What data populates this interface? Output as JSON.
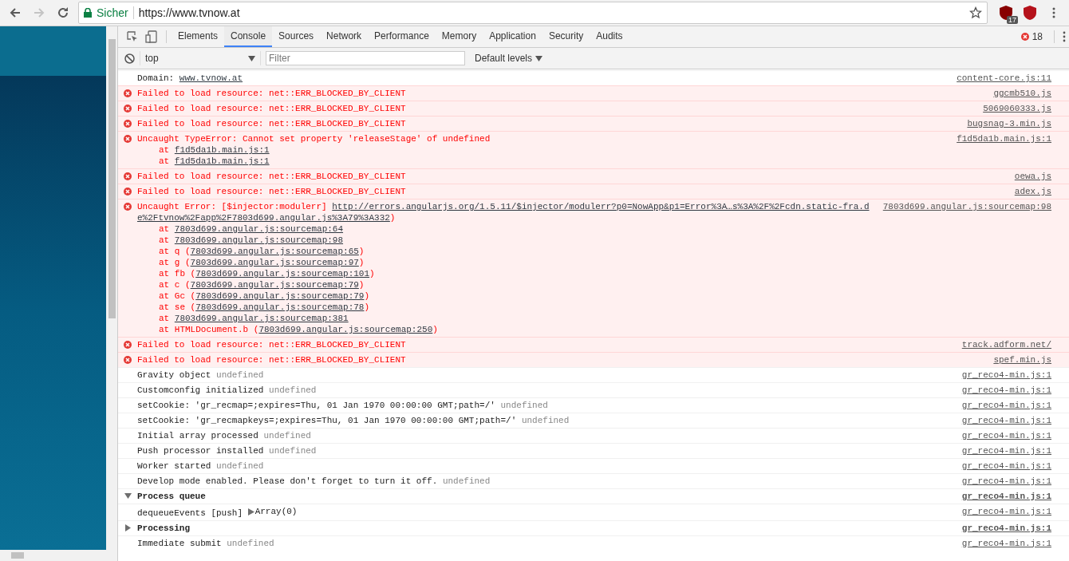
{
  "browser": {
    "forward_disabled": true,
    "security_label": "Sicher",
    "url": "https://www.tvnow.at",
    "extension_badge": "17"
  },
  "devtools": {
    "tabs": [
      {
        "label": "Elements",
        "selected": false
      },
      {
        "label": "Console",
        "selected": true
      },
      {
        "label": "Sources",
        "selected": false
      },
      {
        "label": "Network",
        "selected": false
      },
      {
        "label": "Performance",
        "selected": false
      },
      {
        "label": "Memory",
        "selected": false
      },
      {
        "label": "Application",
        "selected": false
      },
      {
        "label": "Security",
        "selected": false
      },
      {
        "label": "Audits",
        "selected": false
      }
    ],
    "error_count": "18",
    "context": "top",
    "filter_placeholder": "Filter",
    "levels": "Default levels",
    "messages": [
      {
        "kind": "log",
        "lines": [
          [
            {
              "t": "Domain: ",
              "kind": "text"
            },
            {
              "t": "www.tvnow.at",
              "kind": "link"
            }
          ]
        ],
        "source": "content-core.js:11"
      },
      {
        "kind": "error",
        "lines": [
          [
            {
              "t": "Failed to load resource: net::ERR_BLOCKED_BY_CLIENT",
              "kind": "text"
            }
          ]
        ],
        "source": "ggcmb510.js"
      },
      {
        "kind": "error",
        "lines": [
          [
            {
              "t": "Failed to load resource: net::ERR_BLOCKED_BY_CLIENT",
              "kind": "text"
            }
          ]
        ],
        "source": "5069060333.js"
      },
      {
        "kind": "error",
        "lines": [
          [
            {
              "t": "Failed to load resource: net::ERR_BLOCKED_BY_CLIENT",
              "kind": "text"
            }
          ]
        ],
        "source": "bugsnag-3.min.js"
      },
      {
        "kind": "error",
        "lines": [
          [
            {
              "t": "Uncaught TypeError: Cannot set property 'releaseStage' of undefined",
              "kind": "text"
            }
          ]
        ],
        "stack": [
          [
            {
              "t": "at ",
              "kind": "text"
            },
            {
              "t": "f1d5da1b.main.js:1",
              "kind": "link"
            }
          ],
          [
            {
              "t": "at ",
              "kind": "text"
            },
            {
              "t": "f1d5da1b.main.js:1",
              "kind": "link"
            }
          ]
        ],
        "source": "f1d5da1b.main.js:1"
      },
      {
        "kind": "error",
        "lines": [
          [
            {
              "t": "Failed to load resource: net::ERR_BLOCKED_BY_CLIENT",
              "kind": "text"
            }
          ]
        ],
        "source": "oewa.js"
      },
      {
        "kind": "error",
        "lines": [
          [
            {
              "t": "Failed to load resource: net::ERR_BLOCKED_BY_CLIENT",
              "kind": "text"
            }
          ]
        ],
        "source": "adex.js"
      },
      {
        "kind": "error",
        "lines": [
          [
            {
              "t": "Uncaught Error: [$injector:modulerr] ",
              "kind": "text"
            },
            {
              "t": "http://errors.angularjs.org/1.5.11/$injector/modulerr?p0=NowApp&p1=Error%3A…s%3A%2F%2Fcdn.static-fra.d",
              "kind": "link"
            }
          ],
          [
            {
              "t": "e%2Ftvnow%2Fapp%2F7803d699.angular.js%3A79%3A332",
              "kind": "link"
            },
            {
              "t": ")",
              "kind": "text"
            }
          ]
        ],
        "stack": [
          [
            {
              "t": "at ",
              "kind": "text"
            },
            {
              "t": "7803d699.angular.js:sourcemap:64",
              "kind": "link"
            }
          ],
          [
            {
              "t": "at ",
              "kind": "text"
            },
            {
              "t": "7803d699.angular.js:sourcemap:98",
              "kind": "link"
            }
          ],
          [
            {
              "t": "at q (",
              "kind": "text"
            },
            {
              "t": "7803d699.angular.js:sourcemap:65",
              "kind": "link"
            },
            {
              "t": ")",
              "kind": "text"
            }
          ],
          [
            {
              "t": "at g (",
              "kind": "text"
            },
            {
              "t": "7803d699.angular.js:sourcemap:97",
              "kind": "link"
            },
            {
              "t": ")",
              "kind": "text"
            }
          ],
          [
            {
              "t": "at fb (",
              "kind": "text"
            },
            {
              "t": "7803d699.angular.js:sourcemap:101",
              "kind": "link"
            },
            {
              "t": ")",
              "kind": "text"
            }
          ],
          [
            {
              "t": "at c (",
              "kind": "text"
            },
            {
              "t": "7803d699.angular.js:sourcemap:79",
              "kind": "link"
            },
            {
              "t": ")",
              "kind": "text"
            }
          ],
          [
            {
              "t": "at Gc (",
              "kind": "text"
            },
            {
              "t": "7803d699.angular.js:sourcemap:79",
              "kind": "link"
            },
            {
              "t": ")",
              "kind": "text"
            }
          ],
          [
            {
              "t": "at se (",
              "kind": "text"
            },
            {
              "t": "7803d699.angular.js:sourcemap:78",
              "kind": "link"
            },
            {
              "t": ")",
              "kind": "text"
            }
          ],
          [
            {
              "t": "at ",
              "kind": "text"
            },
            {
              "t": "7803d699.angular.js:sourcemap:381",
              "kind": "link"
            }
          ],
          [
            {
              "t": "at HTMLDocument.b (",
              "kind": "text"
            },
            {
              "t": "7803d699.angular.js:sourcemap:250",
              "kind": "link"
            },
            {
              "t": ")",
              "kind": "text"
            }
          ]
        ],
        "source": "7803d699.angular.js:sourcemap:98"
      },
      {
        "kind": "error",
        "lines": [
          [
            {
              "t": "Failed to load resource: net::ERR_BLOCKED_BY_CLIENT",
              "kind": "text"
            }
          ]
        ],
        "source": "track.adform.net/"
      },
      {
        "kind": "error",
        "lines": [
          [
            {
              "t": "Failed to load resource: net::ERR_BLOCKED_BY_CLIENT",
              "kind": "text"
            }
          ]
        ],
        "source": "spef.min.js"
      },
      {
        "kind": "log",
        "lines": [
          [
            {
              "t": "Gravity object ",
              "kind": "text"
            },
            {
              "t": "undefined",
              "kind": "muted"
            }
          ]
        ],
        "source": "gr_reco4-min.js:1"
      },
      {
        "kind": "log",
        "lines": [
          [
            {
              "t": "Customconfig initialized ",
              "kind": "text"
            },
            {
              "t": "undefined",
              "kind": "muted"
            }
          ]
        ],
        "source": "gr_reco4-min.js:1"
      },
      {
        "kind": "log",
        "lines": [
          [
            {
              "t": "setCookie: 'gr_recmap=;expires=Thu, 01 Jan 1970 00:00:00 GMT;path=/' ",
              "kind": "text"
            },
            {
              "t": "undefined",
              "kind": "muted"
            }
          ]
        ],
        "source": "gr_reco4-min.js:1"
      },
      {
        "kind": "log",
        "lines": [
          [
            {
              "t": "setCookie: 'gr_recmapkeys=;expires=Thu, 01 Jan 1970 00:00:00 GMT;path=/' ",
              "kind": "text"
            },
            {
              "t": "undefined",
              "kind": "muted"
            }
          ]
        ],
        "source": "gr_reco4-min.js:1"
      },
      {
        "kind": "log",
        "lines": [
          [
            {
              "t": "Initial array processed ",
              "kind": "text"
            },
            {
              "t": "undefined",
              "kind": "muted"
            }
          ]
        ],
        "source": "gr_reco4-min.js:1"
      },
      {
        "kind": "log",
        "lines": [
          [
            {
              "t": "Push processor installed ",
              "kind": "text"
            },
            {
              "t": "undefined",
              "kind": "muted"
            }
          ]
        ],
        "source": "gr_reco4-min.js:1"
      },
      {
        "kind": "log",
        "lines": [
          [
            {
              "t": "Worker started ",
              "kind": "text"
            },
            {
              "t": "undefined",
              "kind": "muted"
            }
          ]
        ],
        "source": "gr_reco4-min.js:1"
      },
      {
        "kind": "log",
        "lines": [
          [
            {
              "t": "Develop mode enabled. Please don't forget to turn it off. ",
              "kind": "text"
            },
            {
              "t": "undefined",
              "kind": "muted"
            }
          ]
        ],
        "source": "gr_reco4-min.js:1"
      },
      {
        "kind": "group",
        "expanded": true,
        "lines": [
          [
            {
              "t": "Process queue",
              "kind": "text"
            }
          ]
        ],
        "source": "gr_reco4-min.js:1"
      },
      {
        "kind": "log",
        "lines": [
          [
            {
              "t": "dequeueEvents [push] ",
              "kind": "text"
            },
            {
              "t": "Array(0)",
              "kind": "object"
            }
          ]
        ],
        "source": "gr_reco4-min.js:1"
      },
      {
        "kind": "group",
        "expanded": false,
        "lines": [
          [
            {
              "t": "Processing",
              "kind": "text"
            }
          ]
        ],
        "source": "gr_reco4-min.js:1"
      },
      {
        "kind": "log",
        "lines": [
          [
            {
              "t": "Immediate submit ",
              "kind": "text"
            },
            {
              "t": "undefined",
              "kind": "muted"
            }
          ]
        ],
        "source": "gr_reco4-min.js:1"
      }
    ]
  }
}
